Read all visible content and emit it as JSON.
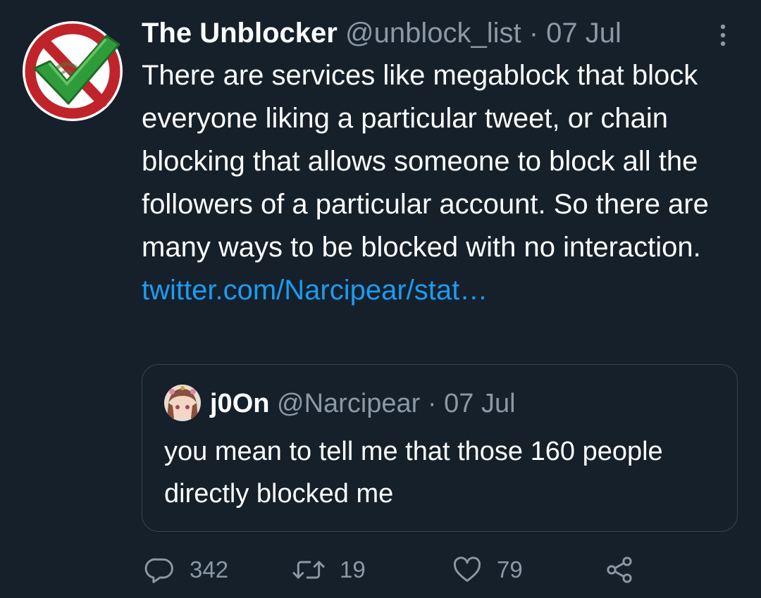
{
  "tweet": {
    "author_name": "The Unblocker",
    "author_handle": "@unblock_list",
    "separator": "·",
    "date": "07 Jul",
    "text": "There are services like megablock that block everyone liking a particular tweet, or chain blocking that allows someone to block all the followers of a particular account. So there are many ways to be blocked with no interaction.",
    "link": "twitter.com/Narcipear/stat…"
  },
  "quoted_tweet": {
    "author_name": "j0On",
    "author_handle": "@Narcipear",
    "separator": "·",
    "date": "07 Jul",
    "text": "you mean to tell me that those 160 people directly blocked me"
  },
  "actions": {
    "replies": "342",
    "retweets": "19",
    "likes": "79"
  },
  "icons": {
    "avatar": "no-block-checkmark-logo",
    "more": "more-vertical-icon",
    "reply": "reply-icon",
    "retweet": "retweet-icon",
    "like": "heart-icon",
    "share": "share-icon"
  },
  "colors": {
    "background": "#15202b",
    "text": "#ffffff",
    "secondary": "#8b98a5",
    "link": "#1d9bf0",
    "border": "#38444d"
  }
}
